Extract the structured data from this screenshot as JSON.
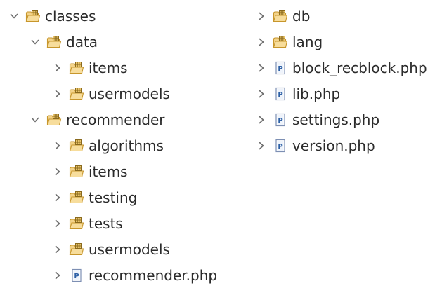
{
  "tree": [
    {
      "label": "classes",
      "type": "package",
      "depth": 0,
      "state": "expanded",
      "pane": "left"
    },
    {
      "label": "data",
      "type": "package",
      "depth": 1,
      "state": "expanded",
      "pane": "left"
    },
    {
      "label": "items",
      "type": "package",
      "depth": 2,
      "state": "collapsed",
      "pane": "left"
    },
    {
      "label": "usermodels",
      "type": "package",
      "depth": 2,
      "state": "collapsed",
      "pane": "left"
    },
    {
      "label": "recommender",
      "type": "package",
      "depth": 1,
      "state": "expanded",
      "pane": "left"
    },
    {
      "label": "algorithms",
      "type": "package",
      "depth": 2,
      "state": "collapsed",
      "pane": "left"
    },
    {
      "label": "items",
      "type": "package",
      "depth": 2,
      "state": "collapsed",
      "pane": "left"
    },
    {
      "label": "testing",
      "type": "package",
      "depth": 2,
      "state": "collapsed",
      "pane": "left"
    },
    {
      "label": "tests",
      "type": "package",
      "depth": 2,
      "state": "collapsed",
      "pane": "left"
    },
    {
      "label": "usermodels",
      "type": "package",
      "depth": 2,
      "state": "collapsed",
      "pane": "left"
    },
    {
      "label": "recommender.php",
      "type": "php-file",
      "depth": 2,
      "state": "collapsed",
      "pane": "left"
    },
    {
      "label": "db",
      "type": "package",
      "depth": 0,
      "state": "collapsed",
      "pane": "right"
    },
    {
      "label": "lang",
      "type": "package",
      "depth": 0,
      "state": "collapsed",
      "pane": "right"
    },
    {
      "label": "block_recblock.php",
      "type": "php-file",
      "depth": 0,
      "state": "collapsed",
      "pane": "right"
    },
    {
      "label": "lib.php",
      "type": "php-file",
      "depth": 0,
      "state": "collapsed",
      "pane": "right"
    },
    {
      "label": "settings.php",
      "type": "php-file",
      "depth": 0,
      "state": "collapsed",
      "pane": "right"
    },
    {
      "label": "version.php",
      "type": "php-file",
      "depth": 0,
      "state": "collapsed",
      "pane": "right"
    }
  ],
  "icons": {
    "package": "package-folder-icon",
    "php-file": "php-file-icon",
    "expanded": "chevron-down-icon",
    "collapsed": "chevron-right-icon"
  },
  "colors": {
    "text": "#2b2b2b",
    "chevron": "#6e6e6e",
    "folder_body": "#f3d38a",
    "folder_stroke": "#c7962c",
    "package_grid": "#8a6a1e",
    "file_body": "#ffffff",
    "file_stroke": "#7d8fb3",
    "file_letter": "#2c5fa5"
  }
}
